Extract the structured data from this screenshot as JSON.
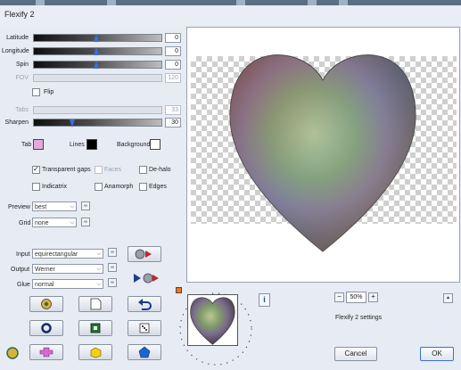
{
  "window": {
    "title": "Flexify 2"
  },
  "sliders": [
    {
      "label": "Latitude",
      "value": "0",
      "position": 0.45
    },
    {
      "label": "Longitude",
      "value": "0",
      "position": 0.45
    },
    {
      "label": "Spin",
      "value": "0",
      "position": 0.45
    },
    {
      "label": "FOV",
      "value": "120",
      "disabled": true
    }
  ],
  "flip_label": "Flip",
  "tabs_slider": {
    "label": "Tabs",
    "value": "33"
  },
  "sharpen_slider": {
    "label": "Sharpen",
    "value": "30",
    "position": 0.3
  },
  "swatches": {
    "tab": {
      "label": "Tab",
      "color": "#e4a9db"
    },
    "lines": {
      "label": "Lines",
      "color": "#000000"
    },
    "background": {
      "label": "Background",
      "color": "#ffffff"
    }
  },
  "options": {
    "transparent_gaps": {
      "label": "Transparent gaps",
      "checked": true
    },
    "faces": {
      "label": "Faces"
    },
    "de_halo": {
      "label": "De-halo"
    },
    "indicatrix": {
      "label": "Indicatrix"
    },
    "anamorph": {
      "label": "Anamorph"
    },
    "edges": {
      "label": "Edges"
    }
  },
  "preview_select": {
    "label": "Preview",
    "value": "best"
  },
  "grid_select": {
    "label": "Grid",
    "value": "none"
  },
  "input_select": {
    "label": "Input",
    "value": "equirectangular"
  },
  "output_select": {
    "label": "Output",
    "value": "Werner"
  },
  "glue_select": {
    "label": "Glue",
    "value": "normal"
  },
  "zoom": {
    "value": "50%",
    "minus": "−",
    "plus": "+"
  },
  "settings_label": "Flexify 2 settings",
  "buttons": {
    "cancel": "Cancel",
    "ok": "OK"
  },
  "info_icon": "i",
  "colors": {
    "accent": "#3a6fd8",
    "tab_swatch": "#e4a9db"
  }
}
